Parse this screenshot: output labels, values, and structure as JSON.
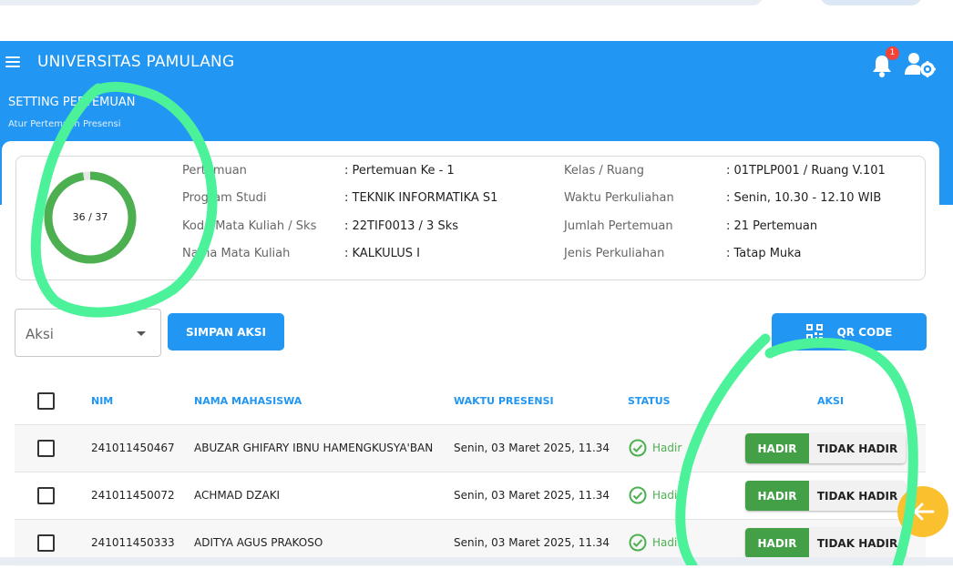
{
  "app": {
    "title": "UNIVERSITAS PAMULANG",
    "notification_count": "1"
  },
  "page": {
    "title": "SETTING PERTEMUAN",
    "subtitle": "Atur Pertemuan Presensi"
  },
  "progress": {
    "text": "36 / 37",
    "current": 36,
    "total": 37,
    "color": "#4caf50"
  },
  "info": {
    "pertemuan": {
      "label": "Pertemuan",
      "value": ": Pertemuan Ke - 1"
    },
    "program_studi": {
      "label": "Program Studi",
      "value": ": TEKNIK INFORMATIKA S1"
    },
    "kode_mk": {
      "label": "Kode Mata Kuliah / Sks",
      "value": ": 22TIF0013 / 3 Sks"
    },
    "nama_mk": {
      "label": "Nama Mata Kuliah",
      "value": ": KALKULUS I"
    },
    "kelas": {
      "label": "Kelas / Ruang",
      "value": ": 01TPLP001 / Ruang V.101"
    },
    "waktu": {
      "label": "Waktu Perkuliahan",
      "value": ": Senin, 10.30 - 12.10 WIB"
    },
    "jumlah": {
      "label": "Jumlah Pertemuan",
      "value": ": 21 Pertemuan"
    },
    "jenis": {
      "label": "Jenis Perkuliahan",
      "value": ": Tatap Muka"
    }
  },
  "actions": {
    "select_label": "Aksi",
    "save_label": "SIMPAN AKSI",
    "qr_label": "QR CODE"
  },
  "table": {
    "headers": {
      "nim": "NIM",
      "nama": "NAMA MAHASISWA",
      "waktu": "WAKTU PRESENSI",
      "status": "STATUS",
      "aksi": "AKSI"
    },
    "rows": [
      {
        "nim": "241011450467",
        "nama": "ABUZAR GHIFARY IBNU HAMENGKUSYA'BAN",
        "waktu": "Senin, 03 Maret 2025, 11.34",
        "status": "Hadir"
      },
      {
        "nim": "241011450072",
        "nama": "ACHMAD DZAKI",
        "waktu": "Senin, 03 Maret 2025, 11.34",
        "status": "Hadir"
      },
      {
        "nim": "241011450333",
        "nama": "ADITYA AGUS PRAKOSO",
        "waktu": "Senin, 03 Maret 2025, 11.34",
        "status": "Hadir"
      }
    ],
    "btn_hadir": "HADIR",
    "btn_tidak_hadir": "TIDAK HADIR"
  },
  "colors": {
    "primary": "#2196f3",
    "success": "#43a047",
    "fab": "#fbc02d",
    "annotation": "#4cf29a"
  }
}
